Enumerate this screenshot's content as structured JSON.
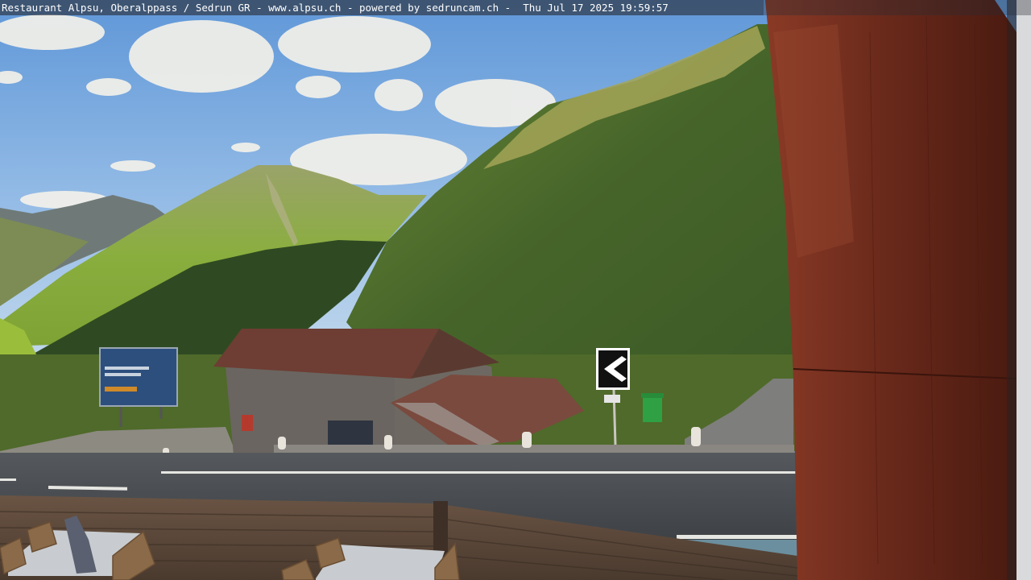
{
  "overlay": {
    "caption": "Restaurant Alpsu, Oberalppass / Sedrun GR - www.alpsu.ch - powered by sedruncam.ch -  Thu Jul 17 2025 19:59:57"
  },
  "scene": {
    "sky_color": "#8fb8e6",
    "grass_sunlit": "#8fb240",
    "grass_shadow": "#3d5a24",
    "roof_color": "#6e3d33",
    "pillar_color": "#6a2a1c"
  }
}
